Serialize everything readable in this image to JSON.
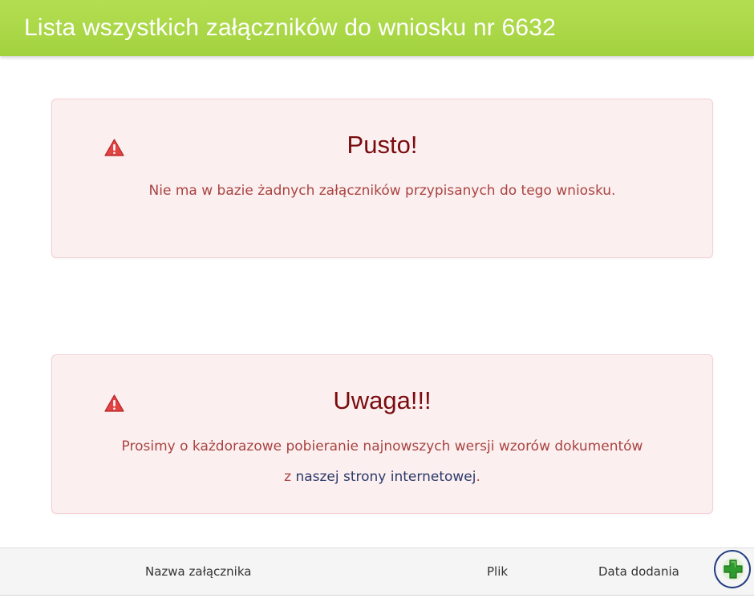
{
  "header": {
    "title": "Lista wszystkich załączników do wniosku nr 6632"
  },
  "alerts": [
    {
      "icon": "warning-icon",
      "title": "Pusto!",
      "text": "Nie ma w bazie żadnych załączników przypisanych do tego wniosku."
    },
    {
      "icon": "warning-icon",
      "title": "Uwaga!!!",
      "text_before": "Prosimy o każdorazowe pobieranie najnowszych wersji wzorów dokumentów z ",
      "link_text": "naszej strony internetowej",
      "text_after": "."
    }
  ],
  "table": {
    "columns": [
      "Nazwa załącznika",
      "Plik",
      "Data dodania"
    ],
    "add_icon": "add-plus-icon"
  },
  "colors": {
    "header": "#a8d545",
    "alert_bg": "#fcefef",
    "alert_title": "#7a0c10",
    "alert_text": "#a94442",
    "link": "#2b3a6b",
    "add_icon": "#2e9b2e",
    "add_ring": "#233f80"
  }
}
